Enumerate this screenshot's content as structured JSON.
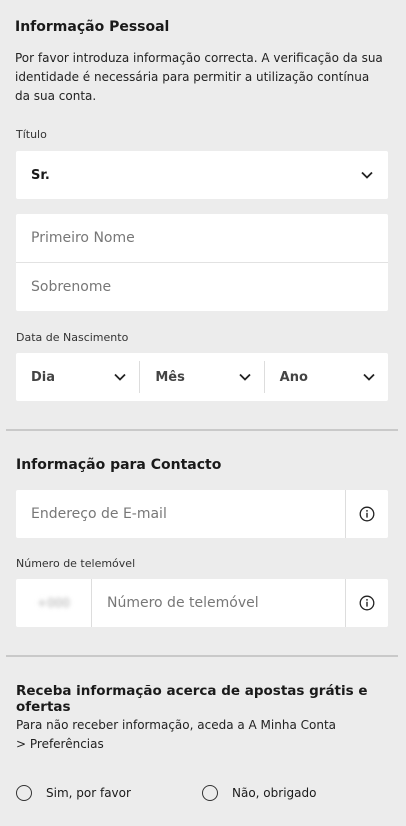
{
  "personal": {
    "title": "Informação Pessoal",
    "description": "Por favor introduza informação correcta. A verificação da sua identidade é necessária para permitir a utilização contínua da sua conta.",
    "titulo_label": "Título",
    "titulo_value": "Sr.",
    "first_name_placeholder": "Primeiro Nome",
    "last_name_placeholder": "Sobrenome",
    "dob_label": "Data de Nascimento",
    "dob_day": "Dia",
    "dob_month": "Mês",
    "dob_year": "Ano"
  },
  "contact": {
    "title": "Informação para Contacto",
    "email_placeholder": "Endereço de E-mail",
    "phone_label": "Número de telemóvel",
    "phone_prefix": "+000",
    "phone_placeholder": "Número de telemóvel"
  },
  "offers": {
    "title": "Receba informação acerca de apostas grátis e ofertas",
    "description": "Para não receber informação, aceda a A Minha Conta > Preferências",
    "yes_label": "Sim, por favor",
    "no_label": "Não, obrigado"
  },
  "icons": {
    "chevron": "chevron-down-icon",
    "info": "info-icon"
  }
}
